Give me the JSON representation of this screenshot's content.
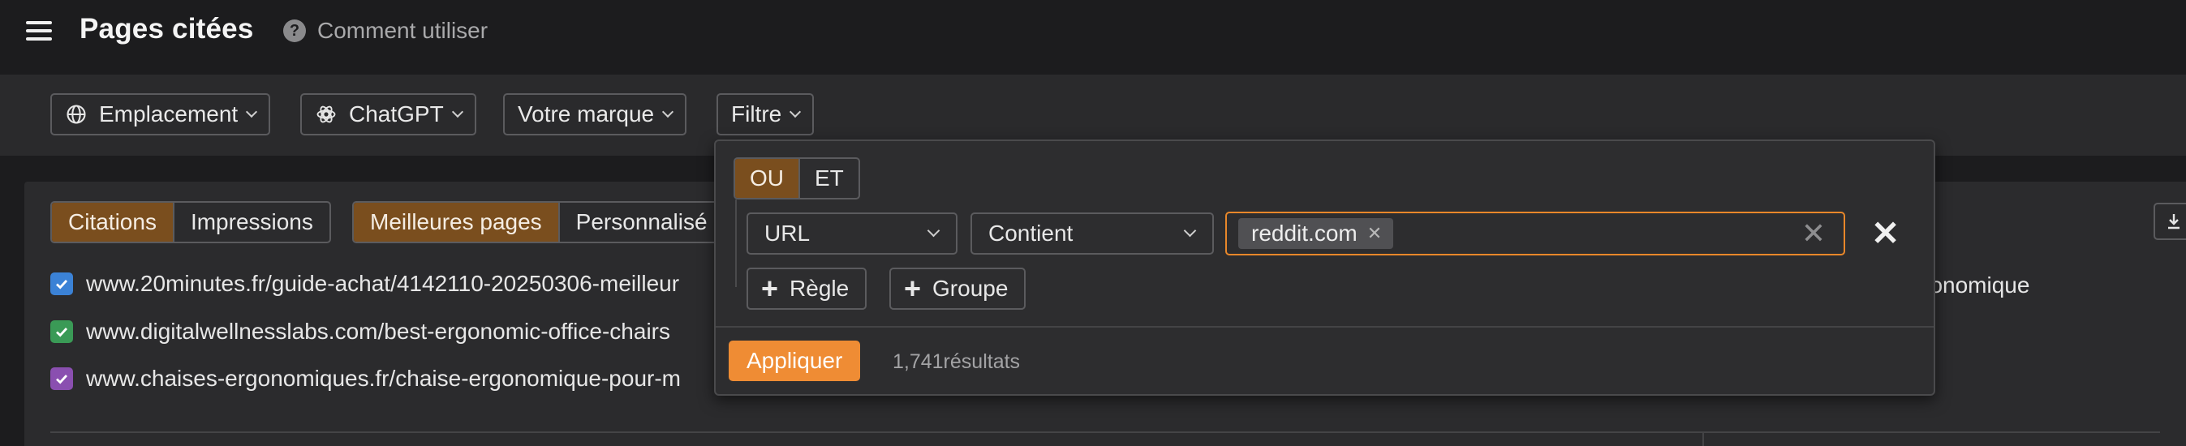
{
  "header": {
    "title": "Pages citées",
    "help_label": "Comment utiliser"
  },
  "filterbar": {
    "location_label": "Emplacement",
    "model_label": "ChatGPT",
    "brand_label": "Votre marque",
    "filter_label": "Filtre"
  },
  "panel": {
    "metric_tabs": [
      "Citations",
      "Impressions"
    ],
    "view_tabs": [
      "Meilleures pages",
      "Personnalisé"
    ],
    "urls": [
      {
        "text": "www.20minutes.fr/guide-achat/4142110-20250306-meilleur",
        "color": "#3b82d6"
      },
      {
        "text": "www.digitalwellnesslabs.com/best-ergonomic-office-chairs",
        "color": "#3a9a56"
      },
      {
        "text": "www.chaises-ergonomiques.fr/chaise-ergonomique-pour-m",
        "color": "#8a4fb0"
      }
    ],
    "right_text": "ergonomique"
  },
  "popover": {
    "logic_options": [
      "OU",
      "ET"
    ],
    "field_value": "URL",
    "operator_value": "Contient",
    "tag_value": "reddit.com",
    "add_rule_label": "Règle",
    "add_group_label": "Groupe",
    "apply_label": "Appliquer",
    "results_label": "1,741résultats"
  },
  "colors": {
    "accent": "#ef8c34",
    "active_tab": "#7a4e1e",
    "input_focus": "#e8872a"
  }
}
